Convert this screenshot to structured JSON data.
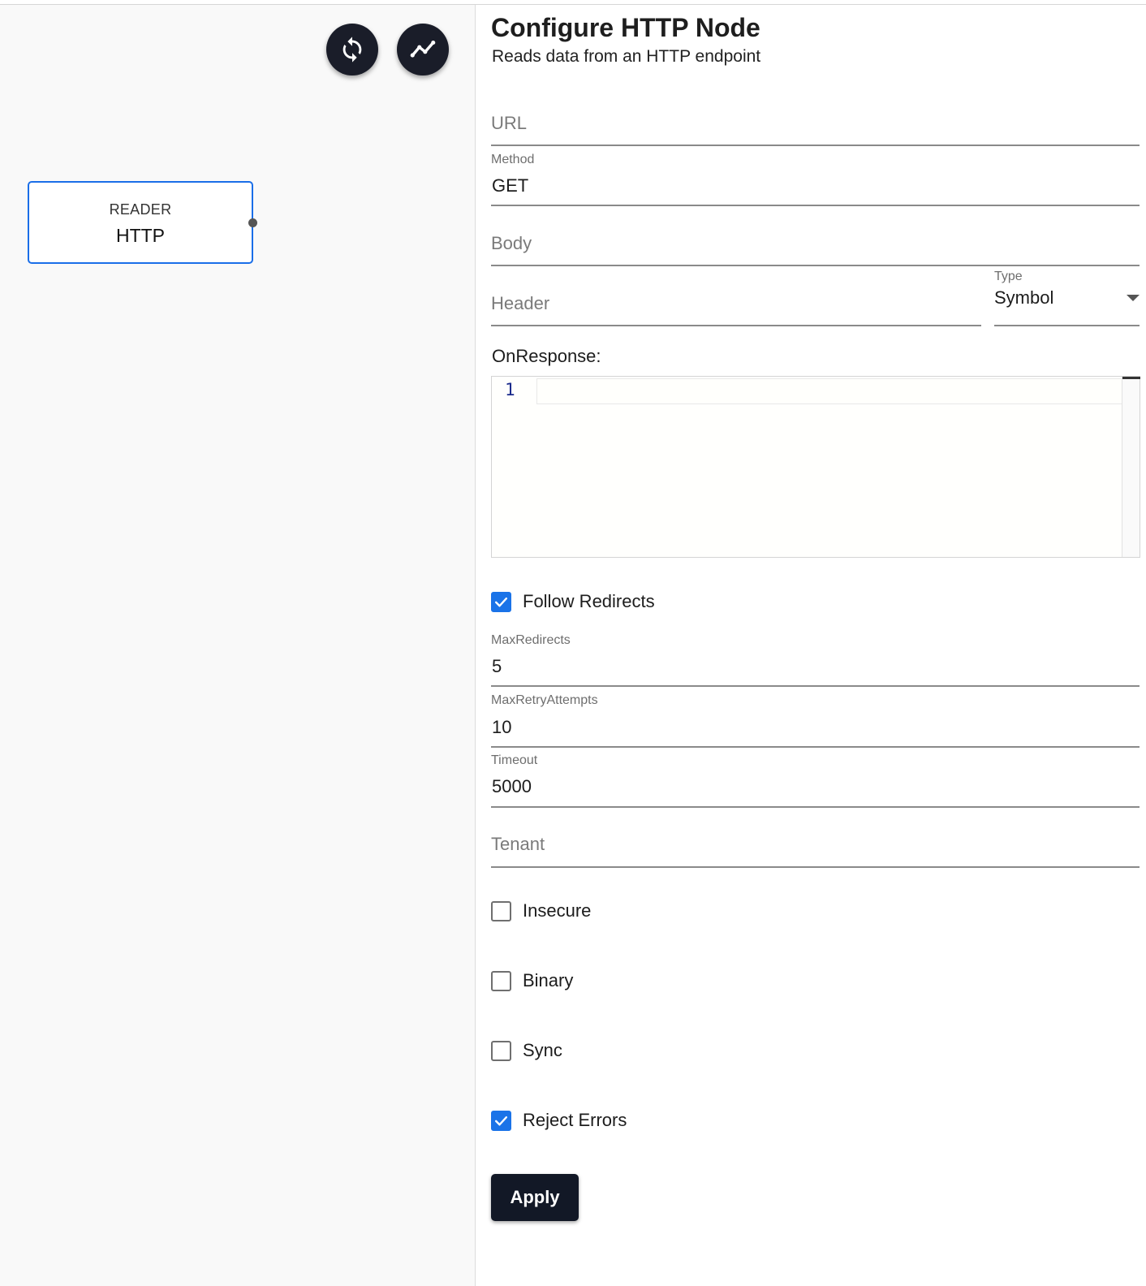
{
  "canvas": {
    "toolbar": {
      "refresh_icon": "refresh-icon",
      "chart_icon": "trend-line-icon"
    },
    "node": {
      "type": "READER",
      "name": "HTTP"
    }
  },
  "panel": {
    "title": "Configure HTTP Node",
    "subtitle": "Reads data from an HTTP endpoint",
    "url": {
      "placeholder": "URL",
      "value": ""
    },
    "method": {
      "label": "Method",
      "value": "GET"
    },
    "body": {
      "placeholder": "Body",
      "value": ""
    },
    "header": {
      "placeholder": "Header",
      "value": ""
    },
    "type": {
      "label": "Type",
      "value": "Symbol"
    },
    "on_response": {
      "label": "OnResponse:",
      "line_number": "1",
      "code": ""
    },
    "follow_redirects": {
      "label": "Follow Redirects",
      "checked": true
    },
    "max_redirects": {
      "label": "MaxRedirects",
      "value": "5"
    },
    "max_retry_attempts": {
      "label": "MaxRetryAttempts",
      "value": "10"
    },
    "timeout": {
      "label": "Timeout",
      "value": "5000"
    },
    "tenant": {
      "placeholder": "Tenant",
      "value": ""
    },
    "insecure": {
      "label": "Insecure",
      "checked": false
    },
    "binary": {
      "label": "Binary",
      "checked": false
    },
    "sync": {
      "label": "Sync",
      "checked": false
    },
    "reject_errors": {
      "label": "Reject Errors",
      "checked": true
    },
    "apply_label": "Apply"
  },
  "colors": {
    "accent": "#1a73e8",
    "node_border": "#1a6ee8",
    "fab": "#1a1d29",
    "button": "#121826"
  }
}
